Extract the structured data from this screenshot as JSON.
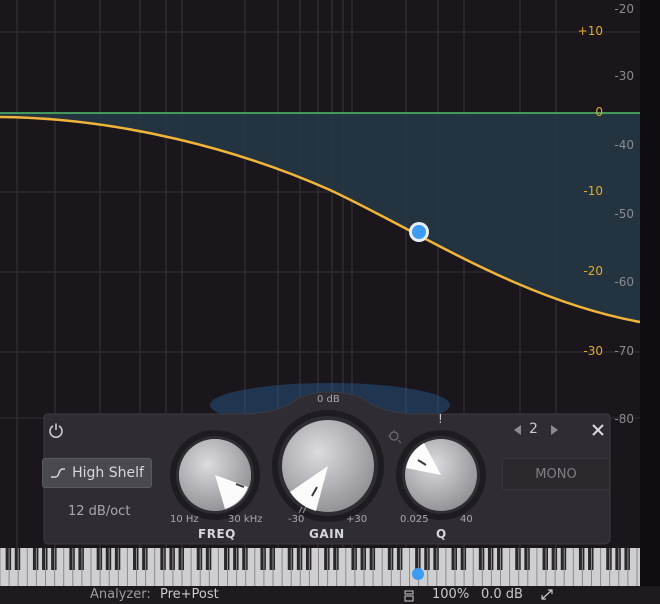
{
  "gain_scale": [
    "+10",
    "0",
    "-10",
    "-20",
    "-30"
  ],
  "db_scale": [
    "-20",
    "-30",
    "-40",
    "-50",
    "-60",
    "-70",
    "-80"
  ],
  "band": {
    "number": "2",
    "shape_label": "High Shelf",
    "slope_label": "12 dB/oct",
    "mono_label": "MONO"
  },
  "knobs": {
    "freq": {
      "label": "FREQ",
      "min": "10 Hz",
      "max": "30 kHz"
    },
    "gain": {
      "label": "GAIN",
      "min": "-30",
      "max": "+30",
      "center": "0 dB"
    },
    "q": {
      "label": "Q",
      "min": "0.025",
      "max": "40",
      "marker": "!"
    }
  },
  "status": {
    "analyzer_label": "Analyzer:",
    "analyzer_value": "Pre+Post",
    "zoom": "100%",
    "output_gain": "0.0 dB"
  },
  "colors": {
    "curve": "#f0b43a",
    "zero_line": "#4fbf6a",
    "fill": "#2a3e4a",
    "node": "#3d9bf0"
  },
  "icons": {
    "power": "power-icon",
    "close": "close-icon",
    "prev": "triangle-left-icon",
    "next": "triangle-right-icon",
    "shelf": "high-shelf-icon",
    "link": "link-icon",
    "phase": "phase-icon",
    "resize": "resize-icon"
  }
}
